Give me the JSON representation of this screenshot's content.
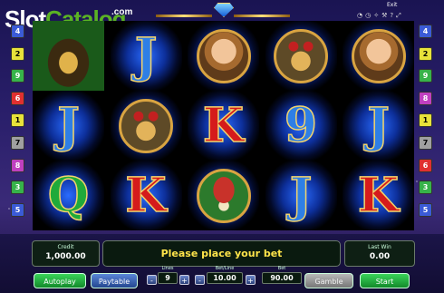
{
  "brand": {
    "part1": "Slot",
    "part2": "Catalog",
    "suffix": ".com"
  },
  "header": {
    "exit_label": "Exit",
    "toolbar_icons": [
      "sound-icon",
      "clock-icon",
      "settings-icon",
      "wrench-icon",
      "help-icon",
      "fullscreen-icon"
    ]
  },
  "paylines": {
    "left": [
      {
        "n": "4",
        "color": "#3b5bd6"
      },
      {
        "n": "2",
        "color": "#e8e23a"
      },
      {
        "n": "9",
        "color": "#37b34a"
      },
      {
        "n": "6",
        "color": "#e03030"
      },
      {
        "n": "1",
        "color": "#e8e23a"
      },
      {
        "n": "7",
        "color": "#a0a0a0"
      },
      {
        "n": "8",
        "color": "#c040c0"
      },
      {
        "n": "3",
        "color": "#37b34a"
      },
      {
        "n": "5",
        "color": "#3b5bd6"
      }
    ],
    "right": [
      {
        "n": "4",
        "color": "#3b5bd6"
      },
      {
        "n": "2",
        "color": "#e8e23a"
      },
      {
        "n": "9",
        "color": "#37b34a"
      },
      {
        "n": "8",
        "color": "#c040c0"
      },
      {
        "n": "1",
        "color": "#e8e23a"
      },
      {
        "n": "7",
        "color": "#a0a0a0"
      },
      {
        "n": "6",
        "color": "#e03030"
      },
      {
        "n": "3",
        "color": "#37b34a"
      },
      {
        "n": "5",
        "color": "#3b5bd6"
      }
    ]
  },
  "reels": [
    [
      {
        "type": "pic",
        "name": "gold-pot"
      },
      {
        "type": "letter",
        "v": "J"
      },
      {
        "type": "letter",
        "v": "Q"
      }
    ],
    [
      {
        "type": "letter",
        "v": "J"
      },
      {
        "type": "pic",
        "name": "dwarfs"
      },
      {
        "type": "letter",
        "v": "K"
      }
    ],
    [
      {
        "type": "pic",
        "name": "woman"
      },
      {
        "type": "letter",
        "v": "K"
      },
      {
        "type": "pic",
        "name": "mushroom"
      }
    ],
    [
      {
        "type": "pic",
        "name": "dwarfs"
      },
      {
        "type": "letter",
        "v": "9"
      },
      {
        "type": "letter",
        "v": "J"
      }
    ],
    [
      {
        "type": "pic",
        "name": "woman"
      },
      {
        "type": "letter",
        "v": "J"
      },
      {
        "type": "letter",
        "v": "K"
      }
    ]
  ],
  "credit": {
    "label": "Credit",
    "value": "1,000.00"
  },
  "message": "Please place your bet",
  "last_win": {
    "label": "Last Win",
    "value": "0.00"
  },
  "buttons": {
    "autoplay": "Autoplay",
    "paytable": "Paytable",
    "gamble": "Gamble",
    "start": "Start",
    "minus": "-",
    "plus": "+"
  },
  "lines": {
    "label": "Lines",
    "value": "9"
  },
  "bet_line": {
    "label": "Bet/Line",
    "value": "10.00"
  },
  "bet": {
    "label": "Bet",
    "value": "90.00"
  }
}
